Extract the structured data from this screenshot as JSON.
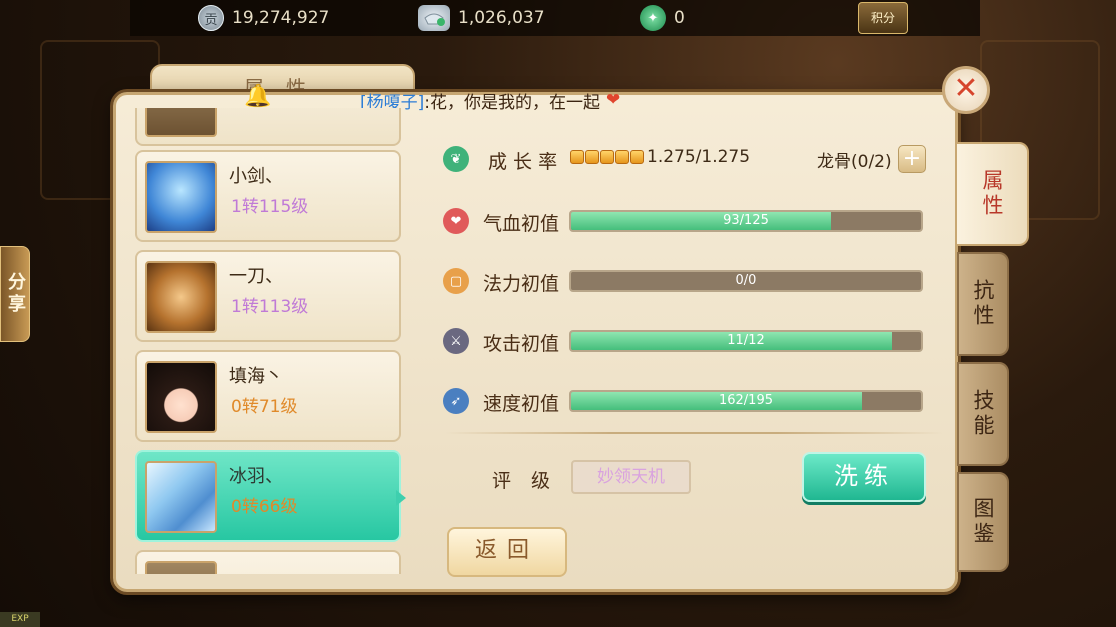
{
  "currencies": {
    "contribution": {
      "icon": "contribution-coin-icon",
      "icon_glyph": "贡",
      "value": "19,274,927"
    },
    "silver": {
      "icon": "silver-ingot-icon",
      "value": "1,026,037"
    },
    "jade": {
      "icon": "jade-icon",
      "value": "0"
    },
    "score_label": "积分"
  },
  "share_label": "分享",
  "exp_label": "EXP",
  "panel_title": "属性",
  "marquee": {
    "speaker": "[杨嗄子]",
    "message": ":花，你是我的，在一起"
  },
  "pets": [
    {
      "name": "小剑、",
      "level": "1转115级",
      "level_color": "purple"
    },
    {
      "name": "一刀、",
      "level": "1转113级",
      "level_color": "purple"
    },
    {
      "name": "填海丶",
      "level": "0转71级",
      "level_color": "orange"
    },
    {
      "name": "冰羽、",
      "level": "0转66级",
      "level_color": "orange",
      "selected": true
    }
  ],
  "growth": {
    "label": "成 长 率",
    "dots": 5,
    "value": "1.275/1.275"
  },
  "dragon_bone": {
    "label": "龙骨(0/2)"
  },
  "stats": [
    {
      "label": "气血初值",
      "text": "93/125",
      "ratio": 0.744,
      "icon": "heart-icon"
    },
    {
      "label": "法力初值",
      "text": "0/0",
      "ratio": 0,
      "icon": "mana-icon"
    },
    {
      "label": "攻击初值",
      "text": "11/12",
      "ratio": 0.917,
      "icon": "sword-icon"
    },
    {
      "label": "速度初值",
      "text": "162/195",
      "ratio": 0.831,
      "icon": "speed-icon"
    }
  ],
  "grade": {
    "label": "评级",
    "value": "妙领天机"
  },
  "buttons": {
    "wash": "洗练",
    "back": "返回"
  },
  "side_tabs": [
    "属性",
    "抗性",
    "技能",
    "图鉴"
  ],
  "colors": {
    "accent_teal": "#2fc9a3",
    "purple_level": "#c07ad6",
    "orange_level": "#e08a2a",
    "bar_fill": "#45be7c"
  }
}
